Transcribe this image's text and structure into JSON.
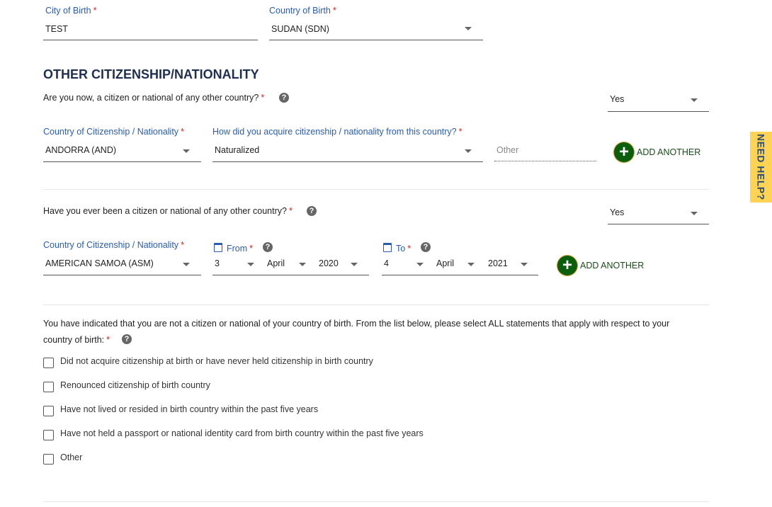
{
  "birth": {
    "city_label": "City of Birth",
    "city_value": "TEST",
    "country_label": "Country of Birth",
    "country_value": "SUDAN (SDN)"
  },
  "section_title": "OTHER CITIZENSHIP/NATIONALITY",
  "current": {
    "question": "Are you now, a citizen or national of any other country?",
    "answer": "Yes",
    "country_label": "Country of Citizenship / Nationality",
    "country_value": "ANDORRA (AND)",
    "how_label": "How did you acquire citizenship / nationality from this country?",
    "how_value": "Naturalized",
    "other_placeholder": "Other",
    "add_label": "ADD ANOTHER"
  },
  "past": {
    "question": "Have you ever been a citizen or national of any other country?",
    "answer": "Yes",
    "country_label": "Country of Citizenship / Nationality",
    "country_value": "AMERICAN SAMOA (ASM)",
    "from_label": "From",
    "from_day": "3",
    "from_month": "April",
    "from_year": "2020",
    "to_label": "To",
    "to_day": "4",
    "to_month": "April",
    "to_year": "2021",
    "add_label": "ADD ANOTHER"
  },
  "statements": {
    "prompt_line1": "You have indicated that you are not a citizen or national of your country of birth. From the list below, please select ALL statements that apply with respect to your",
    "prompt_line2": "country of birth:",
    "options": [
      "Did not acquire citizenship at birth or have never held citizenship in birth country",
      "Renounced citizenship of birth country",
      "Have not lived or resided in birth country within the past five years",
      "Have not held a passport or national identity card from birth country within the past five years",
      "Other"
    ]
  },
  "required_mark": "*",
  "help_glyph": "?",
  "need_help": "NEED HELP?",
  "colors": {
    "label": "#2a5db0",
    "accent_green": "#0b5e0b",
    "help_tab": "#ffd455",
    "required": "#dd2222"
  }
}
